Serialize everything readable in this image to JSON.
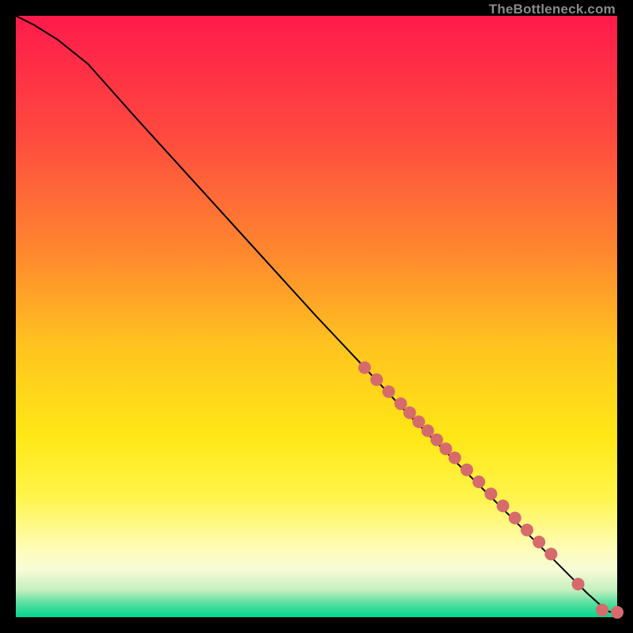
{
  "watermark": "TheBottleneck.com",
  "gradient_stops": [
    {
      "offset": 0.0,
      "color": "#ff1a4b"
    },
    {
      "offset": 0.2,
      "color": "#ff4a3f"
    },
    {
      "offset": 0.4,
      "color": "#ff8a2e"
    },
    {
      "offset": 0.55,
      "color": "#ffc41f"
    },
    {
      "offset": 0.7,
      "color": "#ffe716"
    },
    {
      "offset": 0.8,
      "color": "#fff44a"
    },
    {
      "offset": 0.88,
      "color": "#fffcb0"
    },
    {
      "offset": 0.92,
      "color": "#f8fcd6"
    },
    {
      "offset": 0.955,
      "color": "#c4f0c0"
    },
    {
      "offset": 0.975,
      "color": "#5fe0a0"
    },
    {
      "offset": 1.0,
      "color": "#00d68f"
    }
  ],
  "chart_data": {
    "type": "line",
    "title": "",
    "xlabel": "",
    "ylabel": "",
    "xlim": [
      0,
      100
    ],
    "ylim": [
      0,
      100
    ],
    "series": [
      {
        "name": "curve",
        "color": "#000000",
        "x": [
          0,
          3,
          7,
          12,
          20,
          30,
          40,
          50,
          58,
          65,
          72,
          78,
          83,
          87,
          90,
          93,
          95,
          97,
          98.5,
          100
        ],
        "y": [
          100,
          98.5,
          96,
          92,
          83,
          72,
          61,
          50,
          41.5,
          34,
          27,
          21,
          16,
          12,
          9,
          6,
          4,
          2.2,
          1,
          0.5
        ]
      }
    ],
    "marker_points": {
      "_comment": "clustered salmon markers along the curve, approximate positions",
      "color": "#d66b6b",
      "radius": 8,
      "x": [
        58,
        60,
        62,
        64,
        65.5,
        67,
        68.5,
        70,
        71.5,
        73,
        75,
        77,
        79,
        81,
        83,
        85,
        87,
        89,
        93.5,
        97.5,
        100
      ],
      "y": [
        41.5,
        39.5,
        37.5,
        35.5,
        34,
        32.5,
        31,
        29.5,
        28,
        26.5,
        24.5,
        22.5,
        20.5,
        18.5,
        16.5,
        14.5,
        12.5,
        10.5,
        5.5,
        1.2,
        0.8
      ]
    }
  }
}
